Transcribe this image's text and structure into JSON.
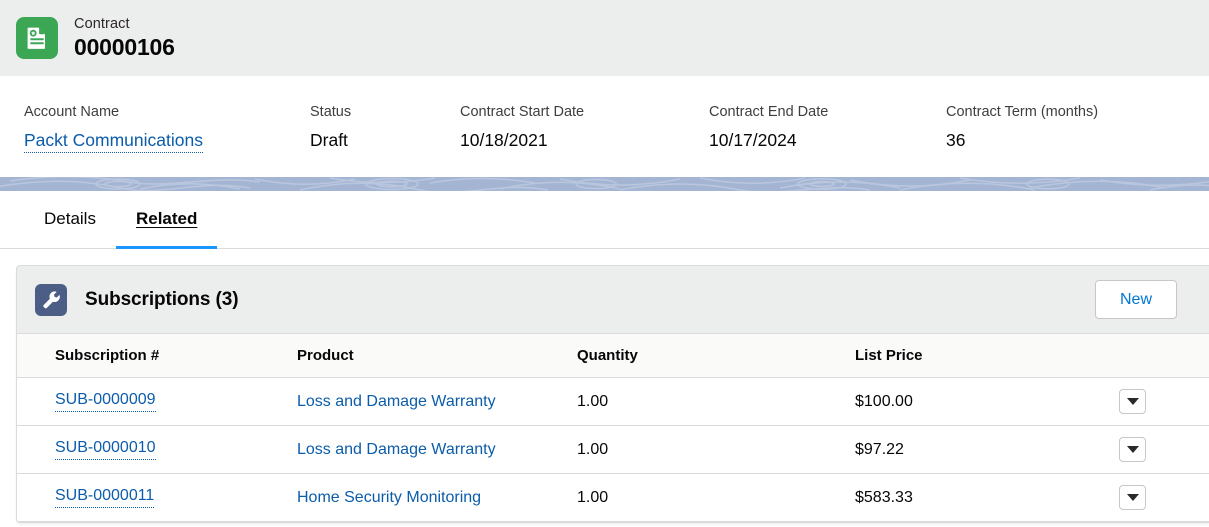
{
  "record_header": {
    "object_type": "Contract",
    "record_name": "00000106",
    "icon": "contract-document-icon",
    "icon_color": "#3ba755"
  },
  "highlights": {
    "fields": [
      {
        "label": "Account Name",
        "value": "Packt Communications",
        "is_link": true
      },
      {
        "label": "Status",
        "value": "Draft",
        "is_link": false
      },
      {
        "label": "Contract Start Date",
        "value": "10/18/2021",
        "is_link": false
      },
      {
        "label": "Contract End Date",
        "value": "10/17/2024",
        "is_link": false
      },
      {
        "label": "Contract Term (months)",
        "value": "36",
        "is_link": false
      }
    ]
  },
  "tabs": [
    {
      "label": "Details",
      "active": false
    },
    {
      "label": "Related",
      "active": true
    }
  ],
  "related_list": {
    "icon": "wrench-icon",
    "icon_color": "#4d5e86",
    "title": "Subscriptions (3)",
    "new_button_label": "New",
    "columns": [
      "Subscription #",
      "Product",
      "Quantity",
      "List Price"
    ],
    "rows": [
      {
        "subscription": "SUB-0000009",
        "product": "Loss and Damage Warranty",
        "quantity": "1.00",
        "list_price": "$100.00",
        "row_menu": "chevron-down-icon"
      },
      {
        "subscription": "SUB-0000010",
        "product": "Loss and Damage Warranty",
        "quantity": "1.00",
        "list_price": "$97.22",
        "row_menu": "chevron-down-icon"
      },
      {
        "subscription": "SUB-0000011",
        "product": "Home Security Monitoring",
        "quantity": "1.00",
        "list_price": "$583.33",
        "row_menu": "chevron-down-icon"
      }
    ]
  },
  "theme": {
    "link_color": "#0b5cab",
    "accent_blue": "#1b96ff",
    "header_bg": "#eceded",
    "band_color": "#a4b5d4"
  }
}
